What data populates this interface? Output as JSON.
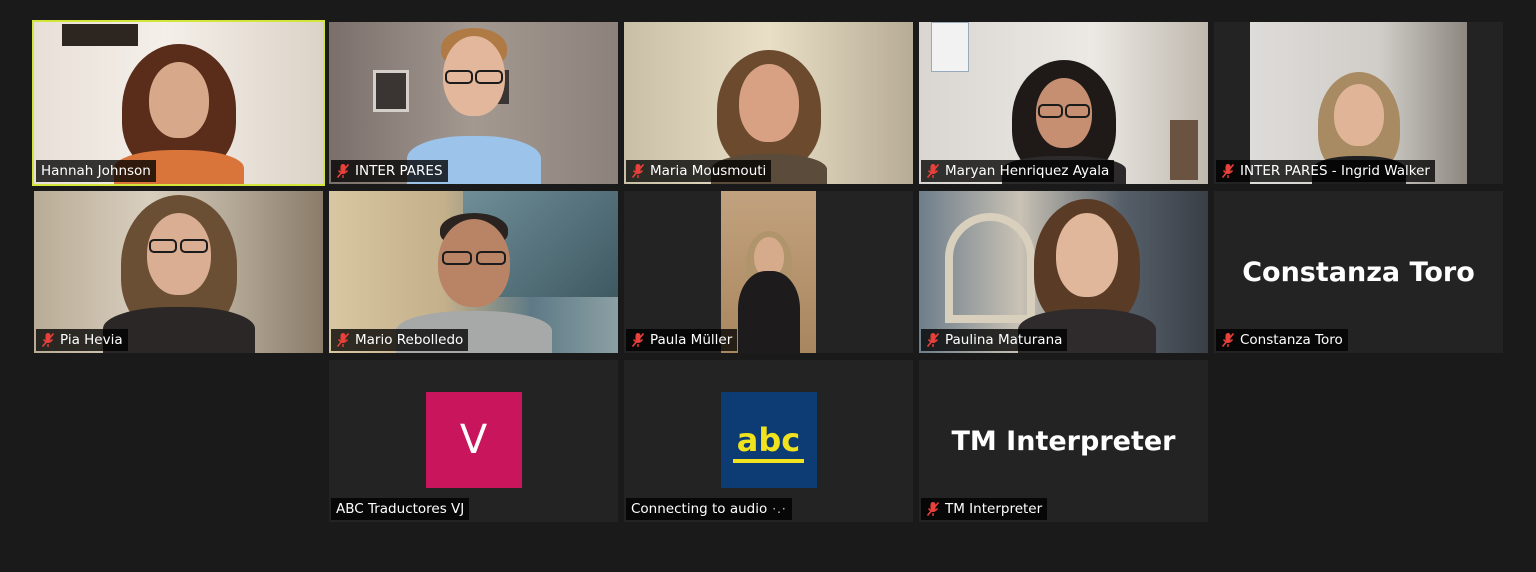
{
  "tiles": [
    {
      "name": "Hannah Johnson",
      "muted": false,
      "active": true
    },
    {
      "name": "INTER PARES",
      "muted": true
    },
    {
      "name": "Maria Mousmouti",
      "muted": true
    },
    {
      "name": "Maryan Henriquez Ayala",
      "muted": true
    },
    {
      "name": "INTER PARES - Ingrid Walker",
      "muted": true
    },
    {
      "name": "Pia Hevia",
      "muted": true
    },
    {
      "name": "Mario Rebolledo",
      "muted": true
    },
    {
      "name": "Paula Müller",
      "muted": true
    },
    {
      "name": "Paulina Maturana",
      "muted": true
    },
    {
      "name": "Constanza Toro",
      "muted": true,
      "center_text": "Constanza Toro"
    },
    {
      "name": "ABC Traductores VJ",
      "muted": false,
      "avatar_text": "V"
    },
    {
      "name": "Connecting to audio",
      "muted": false,
      "avatar_text": "abc",
      "status_glyph": "·.·"
    },
    {
      "name": "TM Interpreter",
      "muted": true,
      "center_text": "TM Interpreter"
    }
  ],
  "colors": {
    "background": "#1a1a1a",
    "tile": "#232323",
    "active_speaker_border": "#d3e53a",
    "muted_icon": "#e8403a",
    "avatar_v": "#c8155c",
    "avatar_abc": "#0d3c75",
    "abc_text": "#f0e21c"
  },
  "icons": {
    "muted": "microphone-muted-icon"
  }
}
